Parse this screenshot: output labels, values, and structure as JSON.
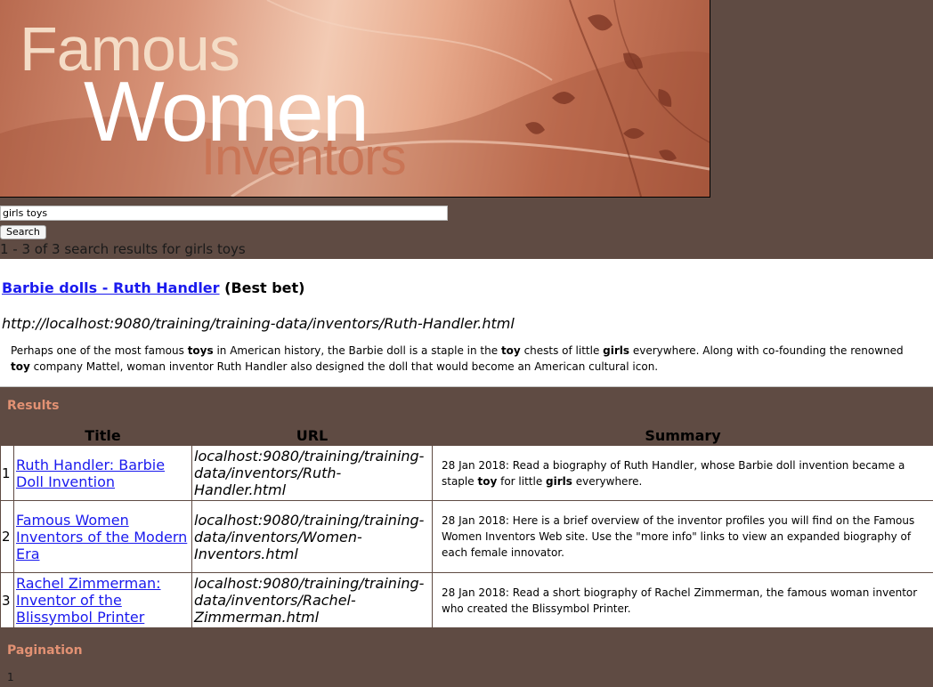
{
  "banner": {
    "line1": "Famous",
    "line2": "Women",
    "line3": "Inventors"
  },
  "search": {
    "value": "girls toys",
    "button_label": "Search",
    "results_count": "1 - 3 of 3 search results for girls toys"
  },
  "best_bet": {
    "title_link": "Barbie dolls - Ruth Handler",
    "tag": "(Best bet)",
    "url": "http://localhost:9080/training/training-data/inventors/Ruth-Handler.html",
    "summary": [
      {
        "t": "Perhaps one of the most famous ",
        "b": false
      },
      {
        "t": "toys",
        "b": true
      },
      {
        "t": " in American history, the Barbie doll is a staple in the ",
        "b": false
      },
      {
        "t": "toy",
        "b": true
      },
      {
        "t": " chests of little ",
        "b": false
      },
      {
        "t": "girls",
        "b": true
      },
      {
        "t": " everywhere. Along with co-founding the renowned ",
        "b": false
      },
      {
        "t": "toy",
        "b": true
      },
      {
        "t": " company Mattel, woman inventor Ruth Handler also designed the doll that would become an American cultural icon.",
        "b": false
      }
    ]
  },
  "results": {
    "heading": "Results",
    "columns": {
      "title": "Title",
      "url": "URL",
      "summary": "Summary"
    },
    "rows": [
      {
        "num": "1",
        "title": "Ruth Handler: Barbie Doll Invention",
        "url": "localhost:9080/training/training-data/inventors/Ruth-Handler.html",
        "summary": [
          {
            "t": "28 Jan 2018: Read a biography of Ruth Handler, whose Barbie doll invention became a staple ",
            "b": false
          },
          {
            "t": "toy",
            "b": true
          },
          {
            "t": " for little ",
            "b": false
          },
          {
            "t": "girls",
            "b": true
          },
          {
            "t": " everywhere.",
            "b": false
          }
        ]
      },
      {
        "num": "2",
        "title": "Famous Women Inventors of the Modern Era",
        "url": "localhost:9080/training/training-data/inventors/Women-Inventors.html",
        "summary": [
          {
            "t": "28 Jan 2018: Here is a brief overview of the inventor profiles you will find on the Famous Women Inventors Web site. Use the \"more info\" links to view an expanded biography of each female innovator.",
            "b": false
          }
        ]
      },
      {
        "num": "3",
        "title": "Rachel Zimmerman: Inventor of the Blissymbol Printer",
        "url": "localhost:9080/training/training-data/inventors/Rachel-Zimmerman.html",
        "summary": [
          {
            "t": "28 Jan 2018: Read a short biography of Rachel Zimmerman, the famous woman inventor who created the Blissymbol Printer.",
            "b": false
          }
        ]
      }
    ]
  },
  "pagination": {
    "heading": "Pagination",
    "current": "1"
  }
}
